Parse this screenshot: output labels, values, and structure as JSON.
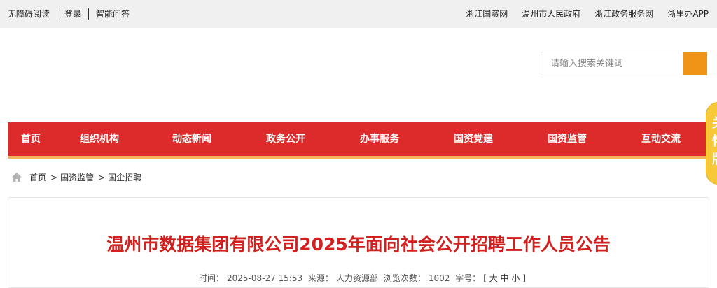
{
  "topbar": {
    "accessibility": "无障碍阅读",
    "login": "登录",
    "qa": "智能问答",
    "links": [
      "浙江国资网",
      "温州市人民政府",
      "浙江政务服务网",
      "浙里办APP"
    ]
  },
  "search": {
    "placeholder": "请输入搜索关键词"
  },
  "nav": {
    "items": [
      "首页",
      "组织机构",
      "动态新闻",
      "政务公开",
      "办事服务",
      "国资党建",
      "国资监管",
      "互动交流"
    ]
  },
  "float_tab": {
    "chars": [
      "关",
      "怀",
      "版"
    ]
  },
  "breadcrumb": {
    "items": [
      "首页",
      "国资监管",
      "国企招聘"
    ],
    "separator": ">"
  },
  "article": {
    "title": "温州市数据集团有限公司2025年面向社会公开招聘工作人员公告",
    "time_label": "时间：",
    "time": "2025-08-27 15:53",
    "source_label": "来源：",
    "source": "人力资源部",
    "views_label": "浏览次数：",
    "views": "1002",
    "font_label": "字号：",
    "font_sizes": "[ 大 中 小 ]"
  },
  "colors": {
    "nav_red": "#dd2a2a",
    "accent_orange": "#ef9416",
    "title_red": "#d1201e"
  }
}
